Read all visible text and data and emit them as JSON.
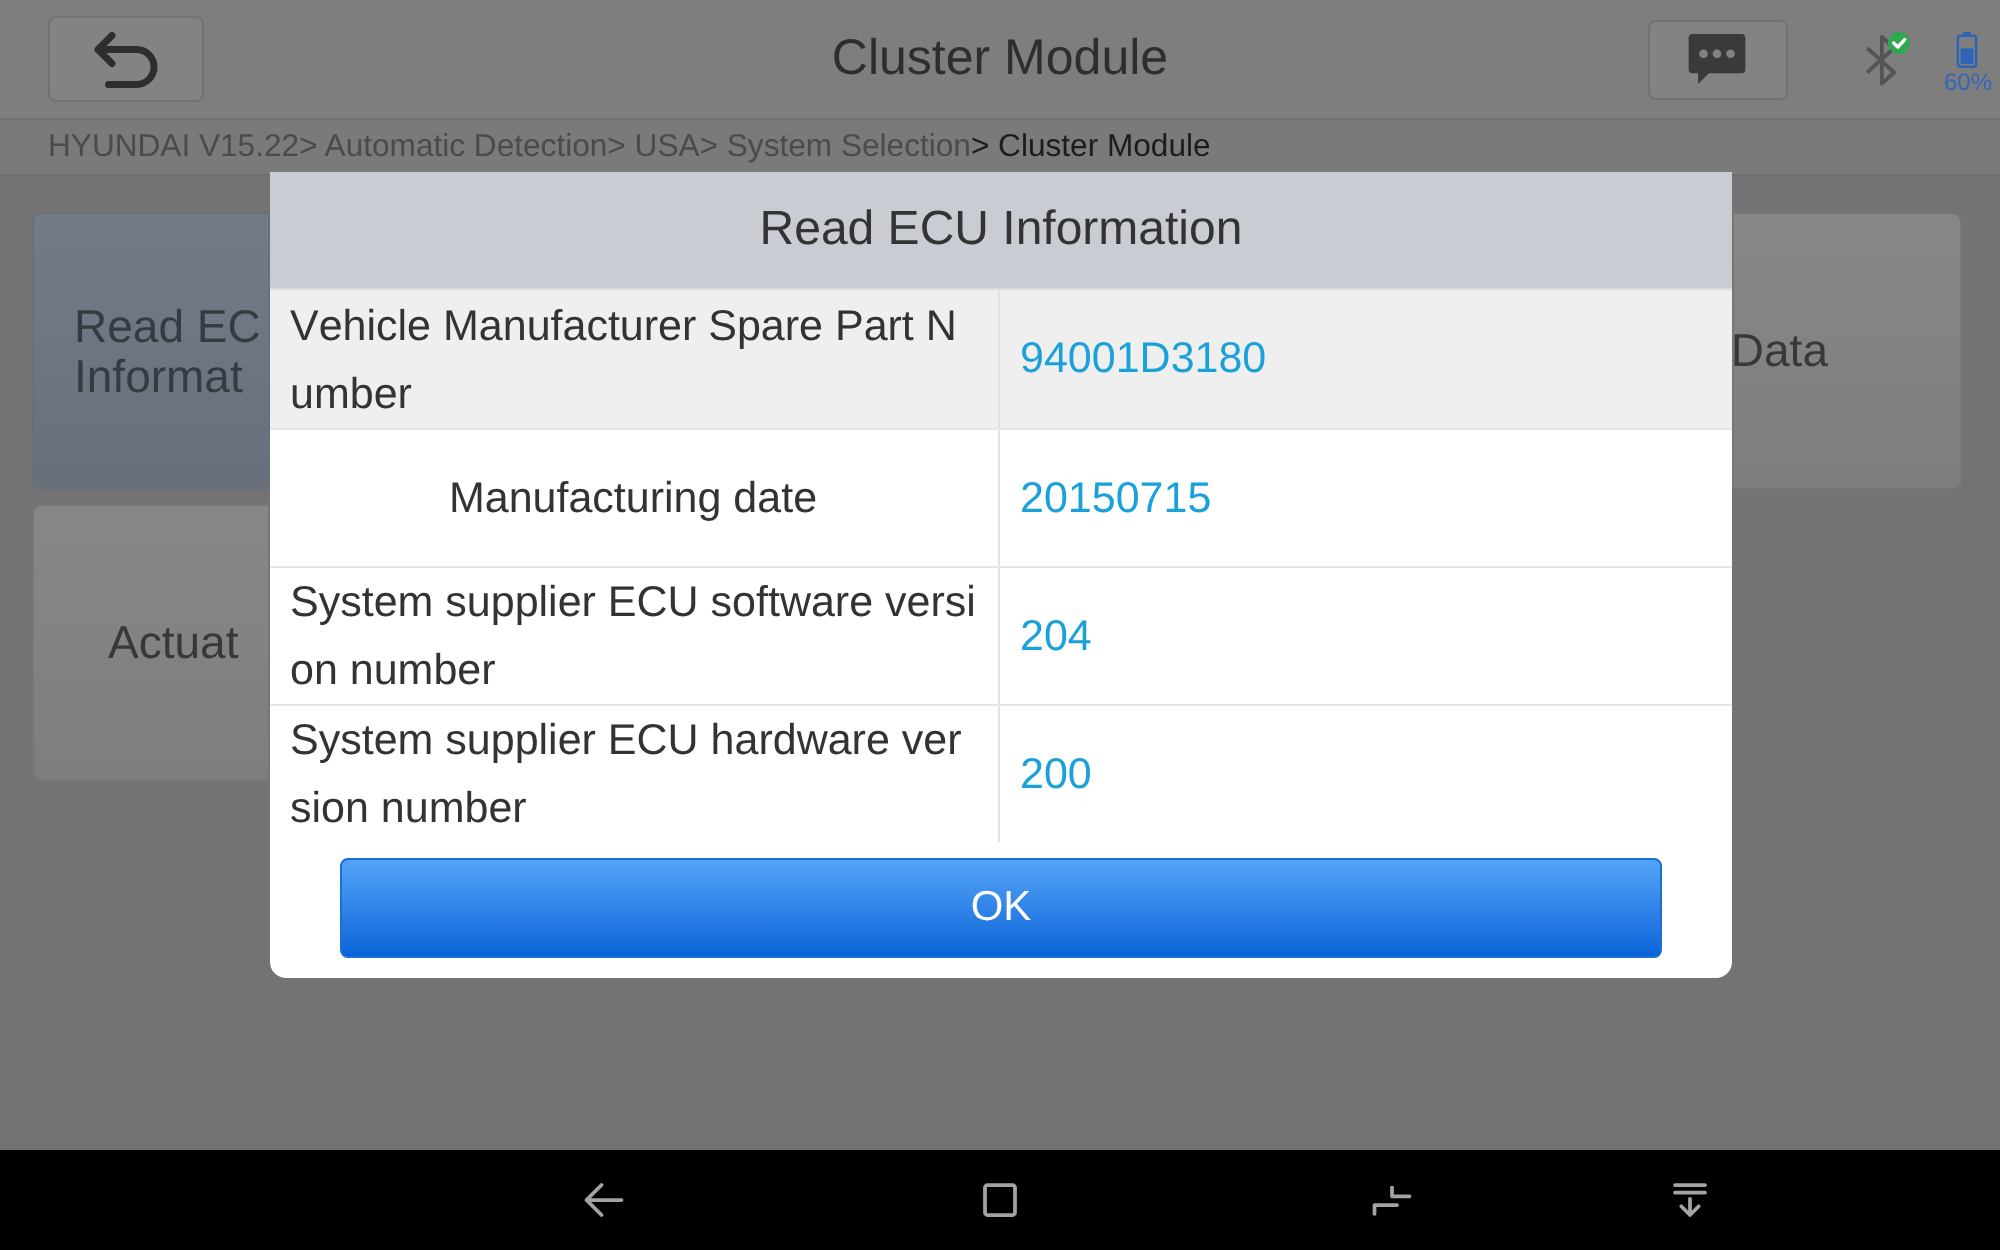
{
  "top_bar": {
    "title": "Cluster Module",
    "battery_percent": "60%"
  },
  "breadcrumb": {
    "separator": ">",
    "items": [
      {
        "label": "HYUNDAI V15.22",
        "current": false
      },
      {
        "label": "Automatic Detection",
        "current": false
      },
      {
        "label": "USA",
        "current": false
      },
      {
        "label": "System Selection",
        "current": false
      },
      {
        "label": "Cluster Module",
        "current": true
      }
    ]
  },
  "function_cards": [
    {
      "lines": [
        "Read EC",
        "Informat"
      ],
      "selected": true
    },
    {
      "lines": [
        "Data"
      ],
      "selected": false
    },
    {
      "lines": [
        "Actuat"
      ],
      "selected": false
    }
  ],
  "dialog": {
    "title": "Read ECU Information",
    "rows": [
      {
        "label": "Vehicle Manufacturer Spare Part Number",
        "value": "94001D3180",
        "highlighted": true
      },
      {
        "label": "Manufacturing date",
        "value": "20150715",
        "highlighted": false
      },
      {
        "label": "System supplier ECU software version number",
        "value": "204",
        "highlighted": false
      },
      {
        "label": "System supplier ECU hardware version number",
        "value": "200",
        "highlighted": false
      }
    ],
    "button": "OK"
  }
}
